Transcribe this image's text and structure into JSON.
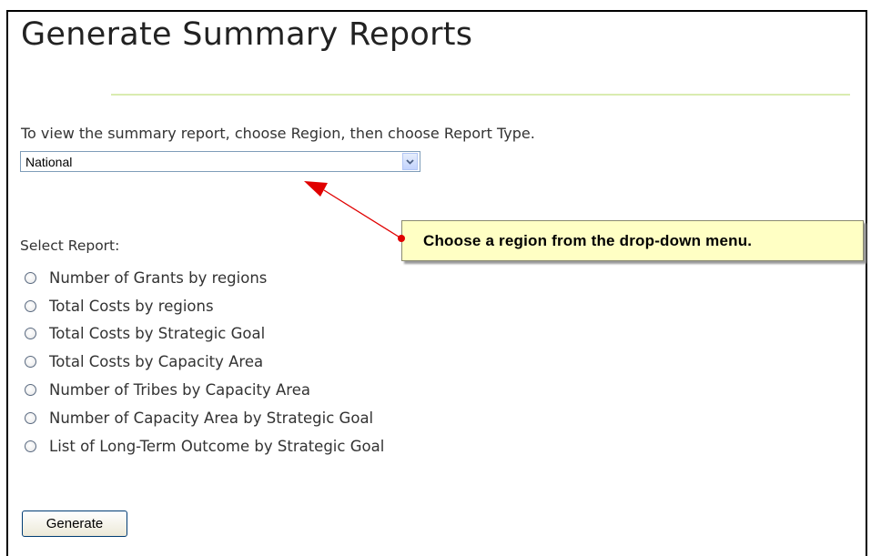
{
  "page": {
    "title": "Generate Summary Reports",
    "instruction": "To view the summary report, choose Region, then choose Report Type."
  },
  "region_select": {
    "selected": "National"
  },
  "reports": {
    "label": "Select Report:",
    "options": [
      "Number of Grants by regions",
      "Total Costs by regions",
      "Total Costs by Strategic Goal",
      "Total Costs by Capacity Area",
      "Number of Tribes by Capacity Area",
      "Number of Capacity Area by Strategic Goal",
      "List of Long-Term Outcome by Strategic Goal"
    ]
  },
  "buttons": {
    "generate": "Generate"
  },
  "callout": {
    "text": "Choose a region from the drop-down menu."
  },
  "colors": {
    "accent_rule": "#d9ecb0",
    "callout_bg": "#ffffc4",
    "arrow": "#e00000"
  },
  "icons": {
    "dropdown": "chevron-down-icon",
    "pointer": "red-arrow-icon"
  }
}
